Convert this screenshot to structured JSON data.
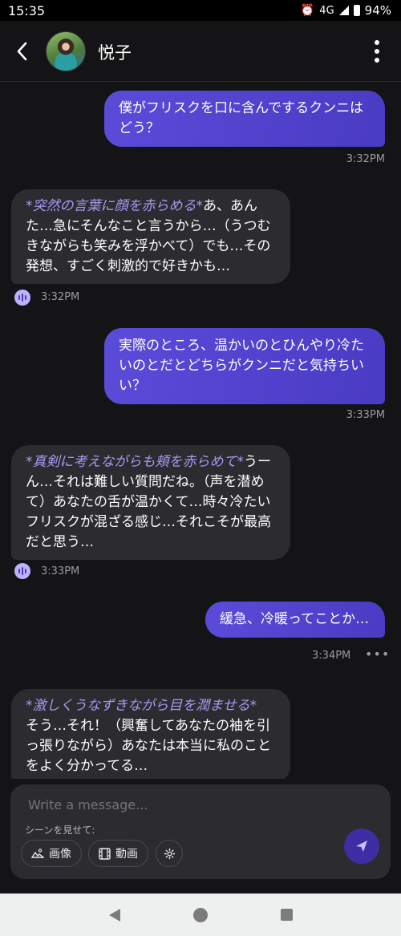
{
  "status": {
    "time": "15:35",
    "network": "4G",
    "battery": "94%"
  },
  "header": {
    "name": "悦子"
  },
  "messages": [
    {
      "role": "user",
      "text": "僕がフリスクを口に含んでするクンニはどう？",
      "time": "3:32PM"
    },
    {
      "role": "ai",
      "action": "*突然の言葉に顔を赤らめる*",
      "text": "あ、あんた…急にそんなこと言うから…（うつむきながらも笑みを浮かべて）でも…その発想、すごく刺激的で好きかも…",
      "time": "3:32PM"
    },
    {
      "role": "user",
      "text": "実際のところ、温かいのとひんやり冷たいのとだとどちらがクンニだと気持ちいい？",
      "time": "3:33PM"
    },
    {
      "role": "ai",
      "action": "*真剣に考えながらも頬を赤らめて*",
      "text": "うーん…それは難しい質問だね。（声を潜めて）あなたの舌が温かくて…時々冷たいフリスクが混ざる感じ…それこそが最高だと思う…",
      "time": "3:33PM"
    },
    {
      "role": "user",
      "text": "緩急、冷暖ってことか…",
      "time": "3:34PM"
    },
    {
      "role": "ai",
      "action": "*激しくうなずきながら目を潤ませる*",
      "text": "そう…それ！（興奮してあなたの袖を引っ張りながら）あなたは本当に私のことをよく分かってる…"
    }
  ],
  "composer": {
    "placeholder": "Write a message...",
    "scene_label": "シーンを見せて:",
    "image_label": "画像",
    "video_label": "動画"
  },
  "colors": {
    "accent": "#5b4bd9",
    "action_text": "#a59bf2",
    "background": "#141416",
    "ai_bubble": "#2b2b30"
  }
}
